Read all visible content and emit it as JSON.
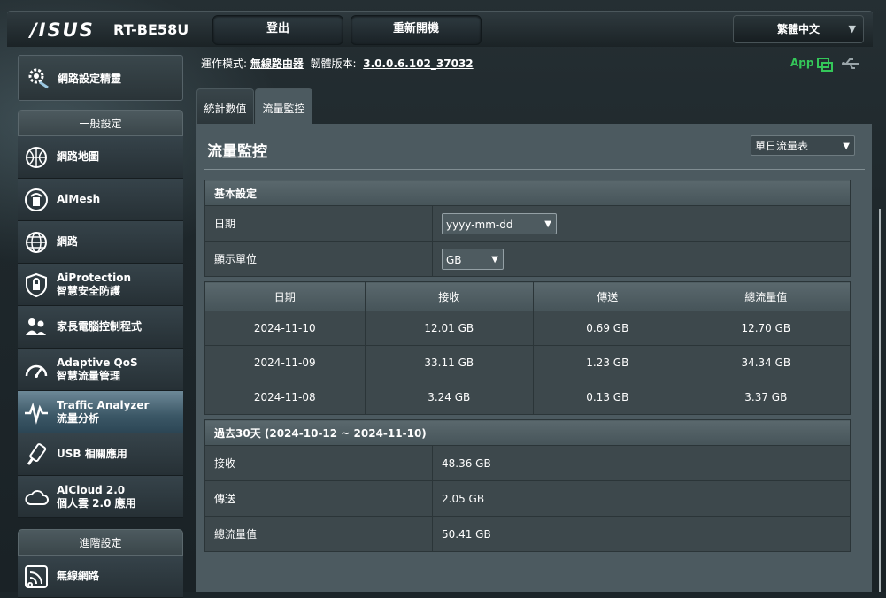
{
  "header": {
    "logo": "/ISUS",
    "model": "RT-BE58U",
    "logout_label": "登出",
    "reboot_label": "重新開機",
    "language": "繁體中文"
  },
  "sidebar": {
    "quick_setup": "網路設定精靈",
    "general_title": "一般設定",
    "items": [
      {
        "label": "網路地圖",
        "sub": "",
        "icon": "globe-map-icon"
      },
      {
        "label": "AiMesh",
        "sub": "",
        "icon": "aimesh-icon"
      },
      {
        "label": "網路",
        "sub": "",
        "icon": "network-globe-icon"
      },
      {
        "label": "AiProtection",
        "sub": "智慧安全防護",
        "icon": "shield-lock-icon"
      },
      {
        "label": "家長電腦控制程式",
        "sub": "",
        "icon": "family-icon"
      },
      {
        "label": "Adaptive QoS",
        "sub": "智慧流量管理",
        "icon": "gauge-icon"
      },
      {
        "label": "Traffic Analyzer",
        "sub": "流量分析",
        "icon": "pulse-icon"
      },
      {
        "label": "USB 相關應用",
        "sub": "",
        "icon": "usb-icon"
      },
      {
        "label": "AiCloud 2.0",
        "sub": "個人雲 2.0 應用",
        "icon": "cloud-icon"
      }
    ],
    "advanced_title": "進階設定",
    "advanced_items": [
      {
        "label": "無線網路",
        "icon": "wireless-icon"
      }
    ]
  },
  "status": {
    "mode_label": "運作模式:",
    "mode_value": "無線路由器",
    "fw_label": "韌體版本:",
    "fw_value": "3.0.0.6.102_37032",
    "app_label": "App"
  },
  "tabs": [
    {
      "label": "統計數值"
    },
    {
      "label": "流量監控"
    }
  ],
  "panel": {
    "title": "流量監控",
    "mode_select": "單日流量表"
  },
  "basic": {
    "title": "基本設定",
    "date_label": "日期",
    "date_value": "yyyy-mm-dd",
    "unit_label": "顯示單位",
    "unit_value": "GB"
  },
  "traffic_table": {
    "headers": [
      "日期",
      "接收",
      "傳送",
      "總流量值"
    ],
    "rows": [
      [
        "2024-11-10",
        "12.01 GB",
        "0.69 GB",
        "12.70 GB"
      ],
      [
        "2024-11-09",
        "33.11 GB",
        "1.23 GB",
        "34.34 GB"
      ],
      [
        "2024-11-08",
        "3.24 GB",
        "0.13 GB",
        "3.37 GB"
      ]
    ]
  },
  "summary": {
    "title": "過去30天 (2024-10-12 ~ 2024-11-10)",
    "rx_label": "接收",
    "rx_value": "48.36 GB",
    "tx_label": "傳送",
    "tx_value": "2.05 GB",
    "total_label": "總流量值",
    "total_value": "50.41 GB"
  },
  "colors": {
    "app_green": "#34c759",
    "active_item": "#4b6878"
  }
}
